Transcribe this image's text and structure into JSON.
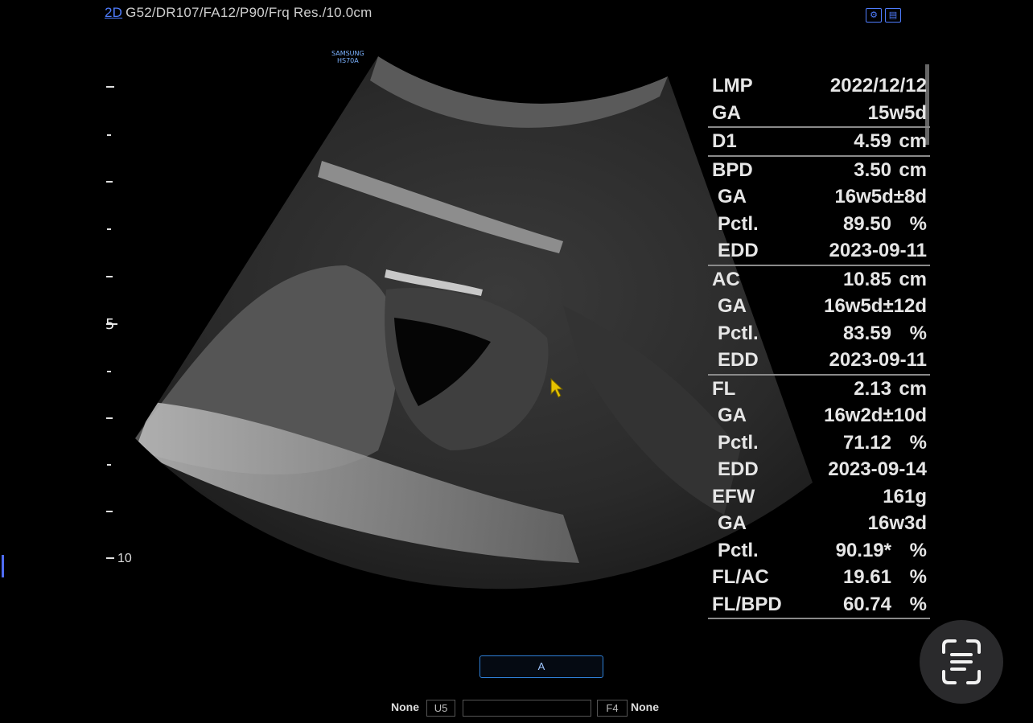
{
  "header": {
    "mode": "2D",
    "params": "G52/DR107/FA12/P90/Frq Res./10.0cm"
  },
  "probe_badge": {
    "line1": "SAMSUNG",
    "line2": "HS70A"
  },
  "depth_scale": {
    "label_bottom": "10",
    "focus_marker": "5"
  },
  "report": {
    "groups": [
      {
        "rows": [
          {
            "label": "LMP",
            "value": "2022/12/12",
            "unit": ""
          },
          {
            "label": "GA",
            "value": "15w5d",
            "unit": ""
          }
        ]
      },
      {
        "rows": [
          {
            "label": "D1",
            "value": "4.59",
            "unit": "cm"
          }
        ]
      },
      {
        "rows": [
          {
            "label": "BPD",
            "value": "3.50",
            "unit": "cm"
          },
          {
            "label": "GA",
            "value": "16w5d±8d",
            "unit": "",
            "sub": true
          },
          {
            "label": "Pctl.",
            "value": "89.50",
            "unit": "%",
            "sub": true
          },
          {
            "label": "EDD",
            "value": "2023-09-11",
            "unit": "",
            "sub": true
          }
        ]
      },
      {
        "rows": [
          {
            "label": "AC",
            "value": "10.85",
            "unit": "cm"
          },
          {
            "label": "GA",
            "value": "16w5d±12d",
            "unit": "",
            "sub": true
          },
          {
            "label": "Pctl.",
            "value": "83.59",
            "unit": "%",
            "sub": true
          },
          {
            "label": "EDD",
            "value": "2023-09-11",
            "unit": "",
            "sub": true
          }
        ]
      },
      {
        "rows": [
          {
            "label": "FL",
            "value": "2.13",
            "unit": "cm"
          },
          {
            "label": "GA",
            "value": "16w2d±10d",
            "unit": "",
            "sub": true
          },
          {
            "label": "Pctl.",
            "value": "71.12",
            "unit": "%",
            "sub": true
          },
          {
            "label": "EDD",
            "value": "2023-09-14",
            "unit": "",
            "sub": true
          },
          {
            "label": "EFW",
            "value": "161g",
            "unit": ""
          },
          {
            "label": "GA",
            "value": "16w3d",
            "unit": "",
            "sub": true
          },
          {
            "label": "Pctl.",
            "value": "90.19*",
            "unit": "%",
            "sub": true
          },
          {
            "label": "FL/AC",
            "value": "19.61",
            "unit": "%"
          },
          {
            "label": "FL/BPD",
            "value": "60.74",
            "unit": "%"
          }
        ]
      }
    ]
  },
  "bottom": {
    "center_button": "A",
    "left_label": "None",
    "left_box": "U5",
    "right_box": "F4",
    "right_label": "None"
  },
  "colors": {
    "accent": "#4f7dff",
    "background": "#000000",
    "button_border": "#2e7fd6"
  },
  "icons": [
    "settings-icon",
    "print-icon",
    "cursor-arrow-icon",
    "text-scan-icon"
  ]
}
